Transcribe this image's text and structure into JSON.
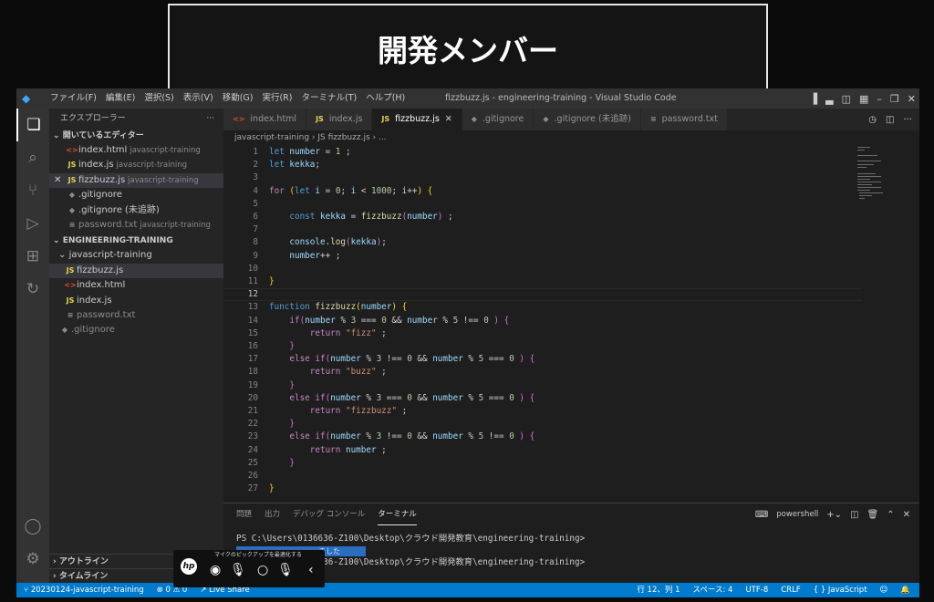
{
  "banner": {
    "title": "開発メンバー"
  },
  "titlebar": {
    "menus": [
      "ファイル(F)",
      "編集(E)",
      "選択(S)",
      "表示(V)",
      "移動(G)",
      "実行(R)",
      "ターミナル(T)",
      "ヘルプ(H)"
    ],
    "window_title": "fizzbuzz.js - engineering-training - Visual Studio Code"
  },
  "sidebar": {
    "header": "エクスプローラー",
    "more": "···",
    "open_editors_title": "開いているエディター",
    "open_editors": [
      {
        "icon": "<>",
        "name": "index.html",
        "desc": "javascript-training"
      },
      {
        "icon": "JS",
        "name": "index.js",
        "desc": "javascript-training"
      },
      {
        "icon": "JS",
        "name": "fizzbuzz.js",
        "desc": "javascript-training",
        "close": "✕"
      },
      {
        "icon": "◆",
        "name": ".gitignore",
        "desc": ""
      },
      {
        "icon": "◆",
        "name": ".gitignore (未追跡)",
        "desc": ""
      },
      {
        "icon": "≡",
        "name": "password.txt",
        "desc": "javascript-training"
      }
    ],
    "workspace_title": "ENGINEERING-TRAINING",
    "folder": "javascript-training",
    "files": [
      {
        "icon": "JS",
        "name": "fizzbuzz.js"
      },
      {
        "icon": "<>",
        "name": "index.html"
      },
      {
        "icon": "JS",
        "name": "index.js"
      },
      {
        "icon": "≡",
        "name": "password.txt"
      }
    ],
    "root_file": ".gitignore",
    "outline": "アウトライン",
    "timeline": "タイムライン"
  },
  "tabs": [
    {
      "icon": "<>",
      "label": "index.html"
    },
    {
      "icon": "JS",
      "label": "index.js"
    },
    {
      "icon": "JS",
      "label": "fizzbuzz.js",
      "close": "✕"
    },
    {
      "icon": "◆",
      "label": ".gitignore"
    },
    {
      "icon": "◆",
      "label": ".gitignore (未追跡)"
    },
    {
      "icon": "≡",
      "label": "password.txt"
    }
  ],
  "breadcrumb": "javascript-training  ›  JS fizzbuzz.js  ›  ...",
  "editor": {
    "current_line": 12,
    "line_numbers": [
      "1",
      "2",
      "3",
      "4",
      "5",
      "6",
      "7",
      "8",
      "9",
      "10",
      "11",
      "12",
      "13",
      "14",
      "15",
      "16",
      "17",
      "18",
      "19",
      "20",
      "21",
      "22",
      "23",
      "24",
      "25",
      "26",
      "27"
    ]
  },
  "panel": {
    "tabs": [
      "問題",
      "出力",
      "デバッグ コンソール",
      "ターミナル"
    ],
    "active_tab": "ターミナル",
    "shell": "powershell",
    "lines": [
      "PS C:\\Users\\0136636-Z100\\Desktop\\クラウド開発教育\\engineering-training>",
      "PS C:\\Users\\0136636-Z100\\Desktop\\クラウド開発教育\\engineering-training>"
    ]
  },
  "statusbar": {
    "branch": "20230124-javascript-training",
    "problems": "⊗ 0 ⚠ 0",
    "live_share": "Live Share",
    "position": "行 12、列 1",
    "spaces": "スペース: 4",
    "encoding": "UTF-8",
    "eol": "CRLF",
    "language": "{ } JavaScript"
  },
  "hp_toolbar": {
    "logo": "hp",
    "label": "マイクのピックアップを最適化する",
    "notification": "ました"
  }
}
